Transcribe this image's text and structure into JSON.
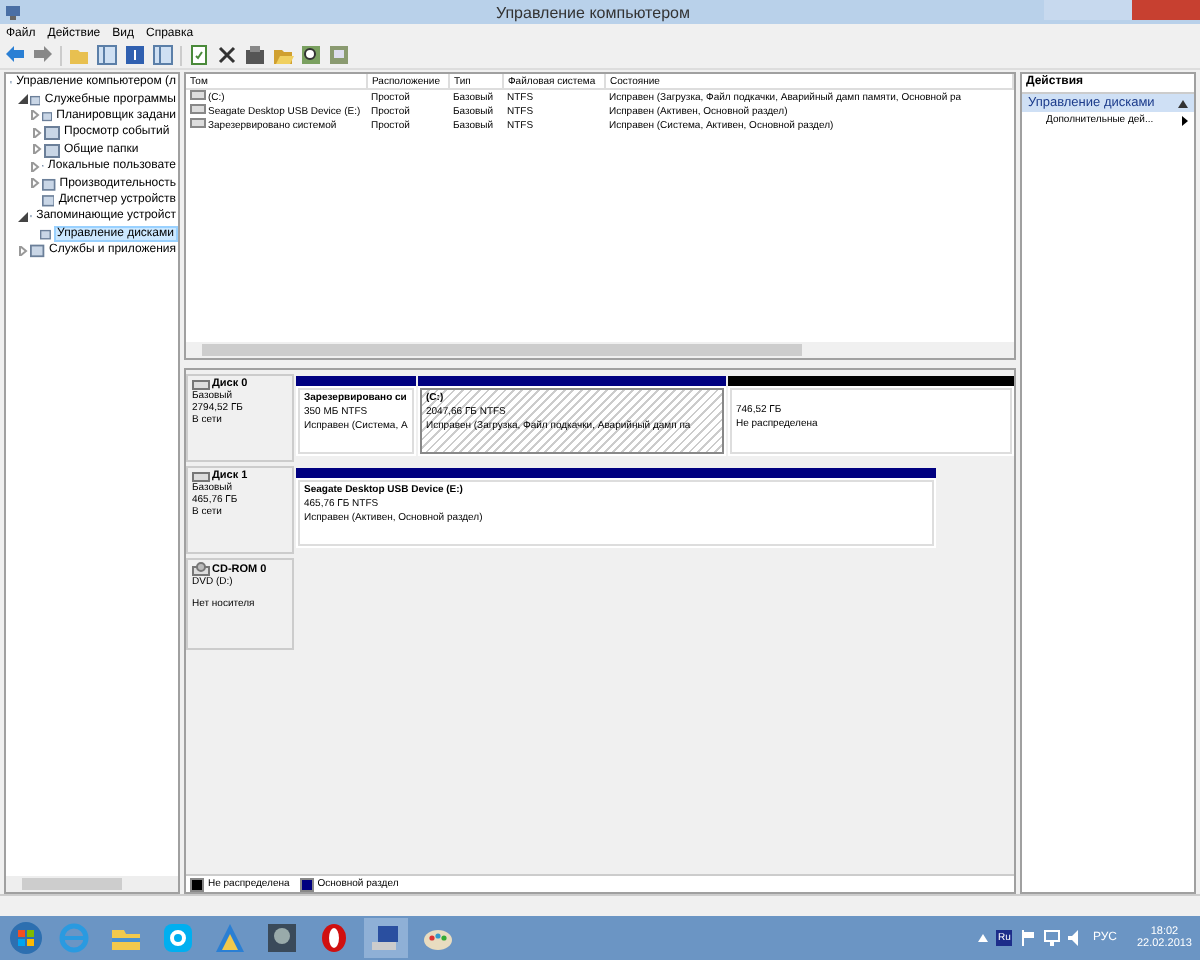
{
  "window": {
    "title": "Управление компьютером"
  },
  "menu": [
    "Файл",
    "Действие",
    "Вид",
    "Справка"
  ],
  "toolbar": [
    {
      "kind": "back"
    },
    {
      "kind": "forward"
    },
    {
      "kind": "folder"
    },
    {
      "kind": "pane"
    },
    {
      "kind": "help"
    },
    {
      "kind": "pane"
    },
    {
      "kind": "refresh"
    },
    {
      "kind": "delete"
    },
    {
      "kind": "properties"
    },
    {
      "kind": "open"
    },
    {
      "kind": "search"
    },
    {
      "kind": "disk"
    }
  ],
  "tree": [
    {
      "label": "Управление компьютером (л",
      "selected": false,
      "children": [
        {
          "label": "Служебные программы",
          "expanded": true,
          "selected": false,
          "children": [
            {
              "label": "Планировщик задани",
              "expanded": false,
              "selected": false
            },
            {
              "label": "Просмотр событий",
              "expanded": false,
              "selected": false
            },
            {
              "label": "Общие папки",
              "expanded": false,
              "selected": false
            },
            {
              "label": "Локальные пользовате",
              "expanded": false,
              "selected": false
            },
            {
              "label": "Производительность",
              "expanded": false,
              "selected": false
            },
            {
              "label": "Диспетчер устройств",
              "selected": false
            }
          ]
        },
        {
          "label": "Запоминающие устройст",
          "expanded": true,
          "selected": false,
          "children": [
            {
              "label": "Управление дисками",
              "selected": true
            }
          ]
        },
        {
          "label": "Службы и приложения",
          "expanded": false,
          "selected": false
        }
      ]
    }
  ],
  "volumes": {
    "columns": [
      "Том",
      "Расположение",
      "Тип",
      "Файловая система",
      "Состояние"
    ],
    "rows": [
      [
        "(C:)",
        "Простой",
        "Базовый",
        "NTFS",
        "Исправен (Загрузка, Файл подкачки, Аварийный дамп памяти, Основной ра"
      ],
      [
        "Seagate Desktop USB Device (E:)",
        "Простой",
        "Базовый",
        "NTFS",
        "Исправен (Активен, Основной раздел)"
      ],
      [
        "Зарезервировано системой",
        "Простой",
        "Базовый",
        "NTFS",
        "Исправен (Система, Активен, Основной раздел)"
      ]
    ]
  },
  "disks": [
    {
      "name": "Диск 0",
      "kind": "hdd",
      "lines": [
        "Базовый",
        "2794,52 ГБ",
        "В сети"
      ],
      "partitions": [
        {
          "kind": "primary",
          "selected": false,
          "title": "Зарезервировано си",
          "size": "350 МБ NTFS",
          "status": "Исправен (Система, А"
        },
        {
          "kind": "primary",
          "selected": true,
          "title": "(C:)",
          "size": "2047,66 ГБ NTFS",
          "status": "Исправен (Загрузка, Файл подкачки, Аварийный дамп па"
        },
        {
          "kind": "unallocated",
          "selected": false,
          "size": "746,52 ГБ",
          "status": "Не распределена"
        }
      ]
    },
    {
      "name": "Диск 1",
      "kind": "hdd",
      "lines": [
        "Базовый",
        "465,76 ГБ",
        "В сети"
      ],
      "partitions": [
        {
          "kind": "primary",
          "selected": false,
          "title": "Seagate Desktop USB Device  (E:)",
          "size": "465,76 ГБ NTFS",
          "status": "Исправен (Активен, Основной раздел)"
        }
      ]
    },
    {
      "name": "CD-ROM 0",
      "kind": "cdrom",
      "lines": [
        "DVD (D:)",
        "Нет носителя"
      ]
    }
  ],
  "legend": [
    {
      "label": "Не распределена",
      "color": "#000000"
    },
    {
      "label": "Основной раздел",
      "color": "#000080"
    }
  ],
  "actions": {
    "header": "Действия",
    "section": "Управление дисками",
    "items": [
      "Дополнительные дей..."
    ]
  },
  "taskbar": [
    {
      "kind": "ie"
    },
    {
      "kind": "explorer"
    },
    {
      "kind": "skype"
    },
    {
      "kind": "triangle"
    },
    {
      "kind": "game"
    },
    {
      "kind": "opera"
    },
    {
      "kind": "computer"
    },
    {
      "kind": "paint"
    }
  ],
  "tray": {
    "language_badge": "Ru",
    "language": "РУС",
    "time": "18:02",
    "date": "22.02.2013"
  }
}
